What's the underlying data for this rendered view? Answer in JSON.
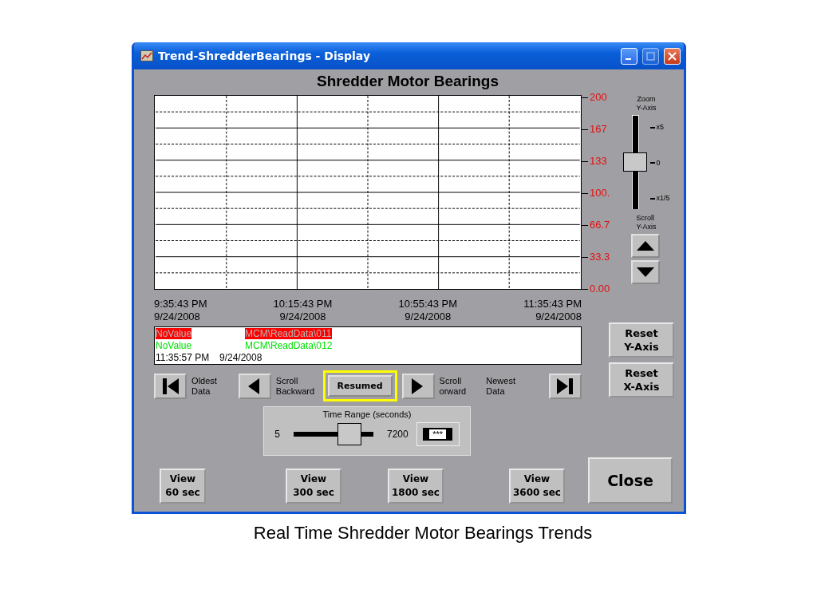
{
  "window": {
    "title": "Trend-ShredderBearings - Display",
    "controls": [
      {
        "kind": "minimize",
        "disabled": false
      },
      {
        "kind": "maximize",
        "disabled": true
      },
      {
        "kind": "close",
        "disabled": false
      }
    ]
  },
  "heading": "Shredder Motor Bearings",
  "y_axis_labels": [
    "200",
    "167",
    "133",
    "100.",
    "66.7",
    "33.3",
    "0.00"
  ],
  "x_axis_labels": [
    {
      "time": "9:35:43 PM",
      "date": "9/24/2008"
    },
    {
      "time": "10:15:43 PM",
      "date": "9/24/2008"
    },
    {
      "time": "10:55:43 PM",
      "date": "9/24/2008"
    },
    {
      "time": "11:35:43 PM",
      "date": "9/24/2008"
    }
  ],
  "legend": [
    {
      "value": "NoValue",
      "tag": "MCM\\ReadData\\011",
      "kind": "highlight",
      "color": "#ff0000"
    },
    {
      "value": "NoValue",
      "tag": "MCM\\ReadData\\012",
      "kind": "text",
      "color": "#00e000"
    }
  ],
  "cursor": {
    "time": "11:35:57 PM",
    "date": "9/24/2008"
  },
  "zoom": {
    "title": "Zoom",
    "subtitle": "Y-Axis",
    "marks": [
      "x5",
      "0",
      "x1/5"
    ],
    "level": 0.5,
    "scroll_label": "Scroll",
    "scroll_sublabel": "Y-Axis"
  },
  "navigation": [
    {
      "kind": "first",
      "label": "Oldest",
      "sublabel": "Data"
    },
    {
      "kind": "back",
      "label": "Scroll",
      "sublabel": "Backward"
    },
    {
      "kind": "pause",
      "label": "Resumed",
      "selected": true
    },
    {
      "kind": "forward",
      "label": "Scroll",
      "sublabel": "orward"
    },
    {
      "kind": "last",
      "label": "Newest",
      "sublabel": "Data"
    }
  ],
  "reset_buttons": [
    {
      "label": "Reset",
      "sublabel": "Y-Axis"
    },
    {
      "label": "Reset",
      "sublabel": "X-Axis"
    }
  ],
  "time_range": {
    "title": "Time Range (seconds)",
    "min": "5",
    "max": "7200",
    "level": 0.7,
    "value": "***"
  },
  "view_buttons": [
    {
      "label": "View",
      "sublabel": "60 sec"
    },
    {
      "label": "View",
      "sublabel": "300 sec"
    },
    {
      "label": "View",
      "sublabel": "1800 sec"
    },
    {
      "label": "View",
      "sublabel": "3600 sec"
    }
  ],
  "close_button": "Close",
  "caption": "Real Time Shredder Motor Bearings Trends"
}
